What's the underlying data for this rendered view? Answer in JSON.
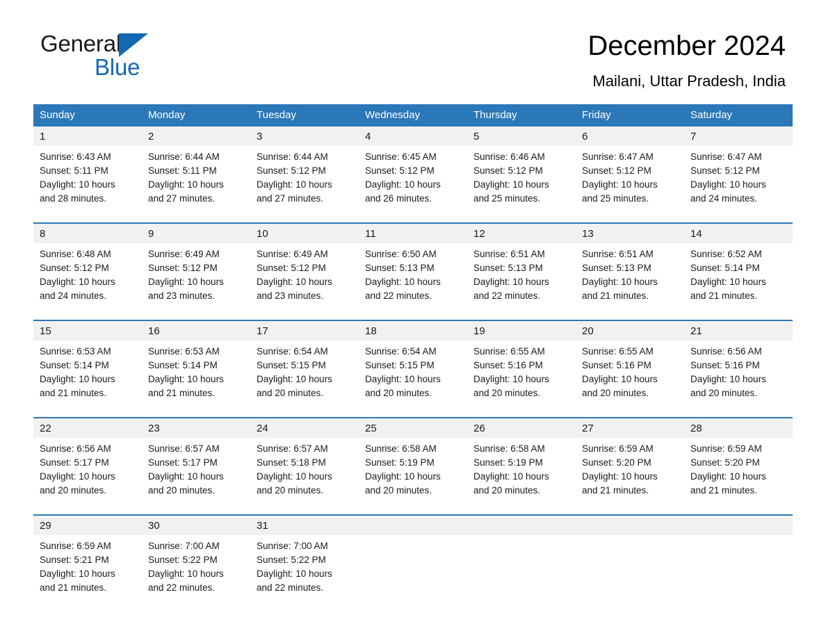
{
  "brand": {
    "name_part1": "General",
    "name_part2": "Blue",
    "triangle_color": "#1268b3"
  },
  "header": {
    "title": "December 2024",
    "subtitle": "Mailani, Uttar Pradesh, India"
  },
  "theme": {
    "header_blue": "#2b78b8",
    "date_band_gray": "#f1f1f1",
    "text_dark": "#1a1a1a"
  },
  "weekdays": [
    "Sunday",
    "Monday",
    "Tuesday",
    "Wednesday",
    "Thursday",
    "Friday",
    "Saturday"
  ],
  "weeks": [
    {
      "dates": [
        "1",
        "2",
        "3",
        "4",
        "5",
        "6",
        "7"
      ],
      "cells": [
        {
          "sunrise": "Sunrise: 6:43 AM",
          "sunset": "Sunset: 5:11 PM",
          "daylight1": "Daylight: 10 hours",
          "daylight2": "and 28 minutes."
        },
        {
          "sunrise": "Sunrise: 6:44 AM",
          "sunset": "Sunset: 5:11 PM",
          "daylight1": "Daylight: 10 hours",
          "daylight2": "and 27 minutes."
        },
        {
          "sunrise": "Sunrise: 6:44 AM",
          "sunset": "Sunset: 5:12 PM",
          "daylight1": "Daylight: 10 hours",
          "daylight2": "and 27 minutes."
        },
        {
          "sunrise": "Sunrise: 6:45 AM",
          "sunset": "Sunset: 5:12 PM",
          "daylight1": "Daylight: 10 hours",
          "daylight2": "and 26 minutes."
        },
        {
          "sunrise": "Sunrise: 6:46 AM",
          "sunset": "Sunset: 5:12 PM",
          "daylight1": "Daylight: 10 hours",
          "daylight2": "and 25 minutes."
        },
        {
          "sunrise": "Sunrise: 6:47 AM",
          "sunset": "Sunset: 5:12 PM",
          "daylight1": "Daylight: 10 hours",
          "daylight2": "and 25 minutes."
        },
        {
          "sunrise": "Sunrise: 6:47 AM",
          "sunset": "Sunset: 5:12 PM",
          "daylight1": "Daylight: 10 hours",
          "daylight2": "and 24 minutes."
        }
      ]
    },
    {
      "dates": [
        "8",
        "9",
        "10",
        "11",
        "12",
        "13",
        "14"
      ],
      "cells": [
        {
          "sunrise": "Sunrise: 6:48 AM",
          "sunset": "Sunset: 5:12 PM",
          "daylight1": "Daylight: 10 hours",
          "daylight2": "and 24 minutes."
        },
        {
          "sunrise": "Sunrise: 6:49 AM",
          "sunset": "Sunset: 5:12 PM",
          "daylight1": "Daylight: 10 hours",
          "daylight2": "and 23 minutes."
        },
        {
          "sunrise": "Sunrise: 6:49 AM",
          "sunset": "Sunset: 5:12 PM",
          "daylight1": "Daylight: 10 hours",
          "daylight2": "and 23 minutes."
        },
        {
          "sunrise": "Sunrise: 6:50 AM",
          "sunset": "Sunset: 5:13 PM",
          "daylight1": "Daylight: 10 hours",
          "daylight2": "and 22 minutes."
        },
        {
          "sunrise": "Sunrise: 6:51 AM",
          "sunset": "Sunset: 5:13 PM",
          "daylight1": "Daylight: 10 hours",
          "daylight2": "and 22 minutes."
        },
        {
          "sunrise": "Sunrise: 6:51 AM",
          "sunset": "Sunset: 5:13 PM",
          "daylight1": "Daylight: 10 hours",
          "daylight2": "and 21 minutes."
        },
        {
          "sunrise": "Sunrise: 6:52 AM",
          "sunset": "Sunset: 5:14 PM",
          "daylight1": "Daylight: 10 hours",
          "daylight2": "and 21 minutes."
        }
      ]
    },
    {
      "dates": [
        "15",
        "16",
        "17",
        "18",
        "19",
        "20",
        "21"
      ],
      "cells": [
        {
          "sunrise": "Sunrise: 6:53 AM",
          "sunset": "Sunset: 5:14 PM",
          "daylight1": "Daylight: 10 hours",
          "daylight2": "and 21 minutes."
        },
        {
          "sunrise": "Sunrise: 6:53 AM",
          "sunset": "Sunset: 5:14 PM",
          "daylight1": "Daylight: 10 hours",
          "daylight2": "and 21 minutes."
        },
        {
          "sunrise": "Sunrise: 6:54 AM",
          "sunset": "Sunset: 5:15 PM",
          "daylight1": "Daylight: 10 hours",
          "daylight2": "and 20 minutes."
        },
        {
          "sunrise": "Sunrise: 6:54 AM",
          "sunset": "Sunset: 5:15 PM",
          "daylight1": "Daylight: 10 hours",
          "daylight2": "and 20 minutes."
        },
        {
          "sunrise": "Sunrise: 6:55 AM",
          "sunset": "Sunset: 5:16 PM",
          "daylight1": "Daylight: 10 hours",
          "daylight2": "and 20 minutes."
        },
        {
          "sunrise": "Sunrise: 6:55 AM",
          "sunset": "Sunset: 5:16 PM",
          "daylight1": "Daylight: 10 hours",
          "daylight2": "and 20 minutes."
        },
        {
          "sunrise": "Sunrise: 6:56 AM",
          "sunset": "Sunset: 5:16 PM",
          "daylight1": "Daylight: 10 hours",
          "daylight2": "and 20 minutes."
        }
      ]
    },
    {
      "dates": [
        "22",
        "23",
        "24",
        "25",
        "26",
        "27",
        "28"
      ],
      "cells": [
        {
          "sunrise": "Sunrise: 6:56 AM",
          "sunset": "Sunset: 5:17 PM",
          "daylight1": "Daylight: 10 hours",
          "daylight2": "and 20 minutes."
        },
        {
          "sunrise": "Sunrise: 6:57 AM",
          "sunset": "Sunset: 5:17 PM",
          "daylight1": "Daylight: 10 hours",
          "daylight2": "and 20 minutes."
        },
        {
          "sunrise": "Sunrise: 6:57 AM",
          "sunset": "Sunset: 5:18 PM",
          "daylight1": "Daylight: 10 hours",
          "daylight2": "and 20 minutes."
        },
        {
          "sunrise": "Sunrise: 6:58 AM",
          "sunset": "Sunset: 5:19 PM",
          "daylight1": "Daylight: 10 hours",
          "daylight2": "and 20 minutes."
        },
        {
          "sunrise": "Sunrise: 6:58 AM",
          "sunset": "Sunset: 5:19 PM",
          "daylight1": "Daylight: 10 hours",
          "daylight2": "and 20 minutes."
        },
        {
          "sunrise": "Sunrise: 6:59 AM",
          "sunset": "Sunset: 5:20 PM",
          "daylight1": "Daylight: 10 hours",
          "daylight2": "and 21 minutes."
        },
        {
          "sunrise": "Sunrise: 6:59 AM",
          "sunset": "Sunset: 5:20 PM",
          "daylight1": "Daylight: 10 hours",
          "daylight2": "and 21 minutes."
        }
      ]
    },
    {
      "dates": [
        "29",
        "30",
        "31",
        "",
        "",
        "",
        ""
      ],
      "cells": [
        {
          "sunrise": "Sunrise: 6:59 AM",
          "sunset": "Sunset: 5:21 PM",
          "daylight1": "Daylight: 10 hours",
          "daylight2": "and 21 minutes."
        },
        {
          "sunrise": "Sunrise: 7:00 AM",
          "sunset": "Sunset: 5:22 PM",
          "daylight1": "Daylight: 10 hours",
          "daylight2": "and 22 minutes."
        },
        {
          "sunrise": "Sunrise: 7:00 AM",
          "sunset": "Sunset: 5:22 PM",
          "daylight1": "Daylight: 10 hours",
          "daylight2": "and 22 minutes."
        },
        {
          "sunrise": "",
          "sunset": "",
          "daylight1": "",
          "daylight2": ""
        },
        {
          "sunrise": "",
          "sunset": "",
          "daylight1": "",
          "daylight2": ""
        },
        {
          "sunrise": "",
          "sunset": "",
          "daylight1": "",
          "daylight2": ""
        },
        {
          "sunrise": "",
          "sunset": "",
          "daylight1": "",
          "daylight2": ""
        }
      ]
    }
  ]
}
